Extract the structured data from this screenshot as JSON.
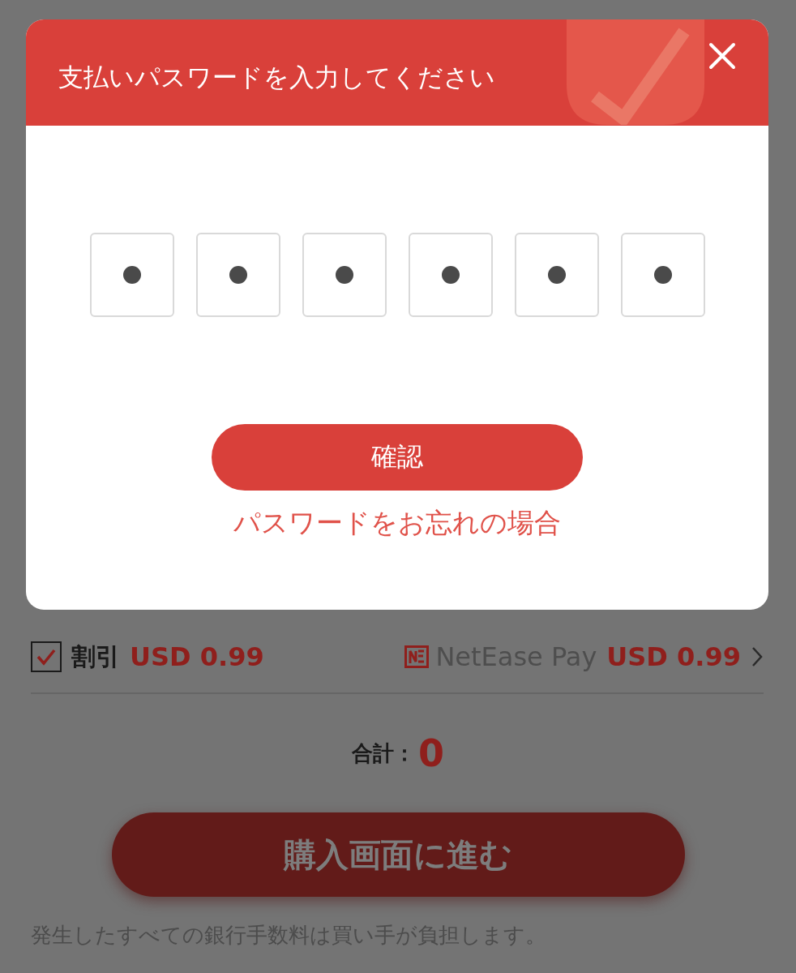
{
  "dialog": {
    "title": "支払いパスワードを入力してください",
    "pin_digits": [
      {
        "filled": true
      },
      {
        "filled": true
      },
      {
        "filled": true
      },
      {
        "filled": true
      },
      {
        "filled": true
      },
      {
        "filled": true
      }
    ],
    "confirm_button": "確認",
    "forgot_link": "パスワードをお忘れの場合"
  },
  "discount": {
    "checked": true,
    "label": "割引",
    "amount": "USD 0.99"
  },
  "payment": {
    "method": "NetEase Pay",
    "amount": "USD 0.99"
  },
  "total": {
    "label": "合計：",
    "value": "0"
  },
  "purchase_button": "購入画面に進む",
  "note": "発生したすべての銀行手数料は買い手が負担します。"
}
